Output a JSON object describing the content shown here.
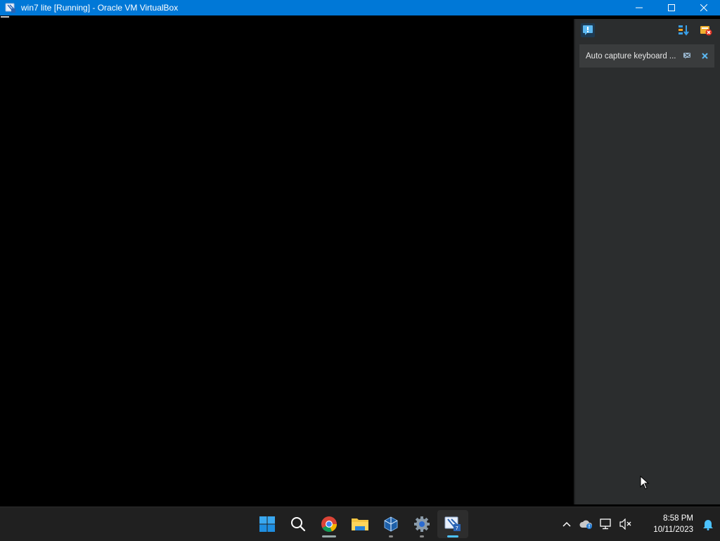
{
  "window": {
    "title": "win7 lite [Running] - Oracle VM VirtualBox",
    "icon": "virtualbox-vm-icon",
    "controls": [
      "minimize-icon",
      "maximize-icon",
      "close-icon"
    ]
  },
  "notification_center": {
    "toolbar_icons": [
      "toggle-notifications-icon",
      "sort-icon",
      "clear-all-icon"
    ],
    "messages": [
      {
        "text": "Auto capture keyboard ...",
        "actions": [
          "do-not-show-again-icon",
          "close-icon"
        ]
      }
    ]
  },
  "taskbar": {
    "apps": [
      {
        "name": "Start",
        "icon": "windows-start-icon"
      },
      {
        "name": "Search",
        "icon": "search-icon"
      },
      {
        "name": "Google Chrome",
        "icon": "chrome-icon"
      },
      {
        "name": "File Explorer",
        "icon": "folder-icon"
      },
      {
        "name": "Oracle VM VirtualBox",
        "icon": "virtualbox-icon"
      },
      {
        "name": "Settings",
        "icon": "gear-icon"
      },
      {
        "name": "win7 lite",
        "icon": "virtualbox-vm-icon"
      }
    ],
    "tray": {
      "icons": [
        "chevron-up-icon",
        "onedrive-icon",
        "network-icon",
        "volume-muted-icon",
        "notification-bell-icon"
      ],
      "time": "8:58 PM",
      "date": "10/11/2023"
    }
  },
  "colors": {
    "titlebar": "#0078d7",
    "accent": "#4cc2ff",
    "taskbar": "#202020",
    "panel": "#2b2d2e"
  }
}
